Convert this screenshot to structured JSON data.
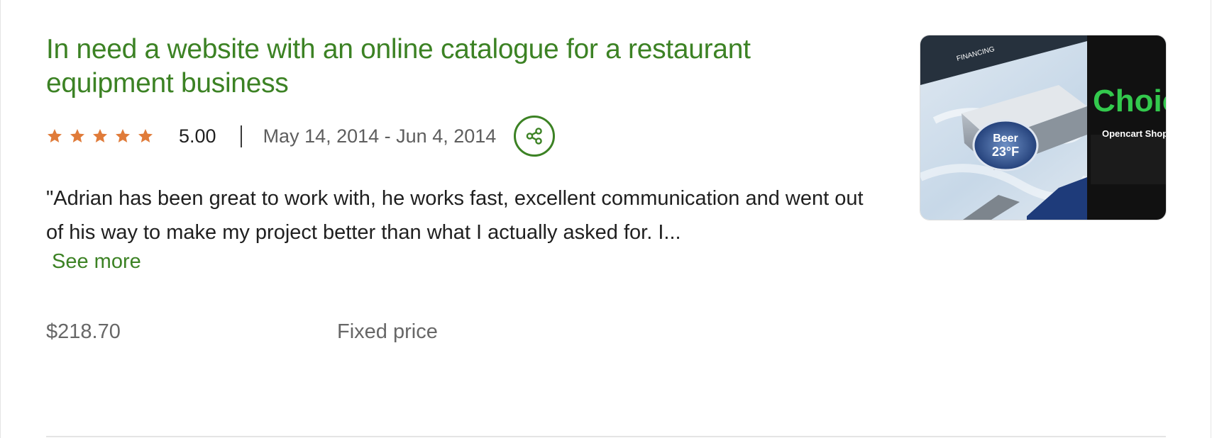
{
  "item": {
    "title": "In need a website with an online catalogue for a restaurant equipment business",
    "rating": {
      "value": "5.00",
      "stars_filled": 5,
      "stars_total": 5,
      "star_color": "#e07b39"
    },
    "date_range": "May 14, 2014 - Jun 4, 2014",
    "review": "\"Adrian has been great to work with, he works fast, excellent communication and went out of his way to make my project better than what I actually asked for. I...",
    "see_more_label": "See more",
    "price": "$218.70",
    "contract_type": "Fixed price",
    "thumbnail": {
      "nav_text": "FINANCING",
      "brand_text": "Choice",
      "sub_text": "Opencart Shop",
      "sign_line1": "Beer",
      "sign_line2": "23°F"
    }
  },
  "colors": {
    "accent_green": "#3c8224",
    "text_dark": "#1f1f1f",
    "text_muted": "#676767"
  },
  "icons": {
    "share": "share-icon",
    "star": "star-icon"
  }
}
